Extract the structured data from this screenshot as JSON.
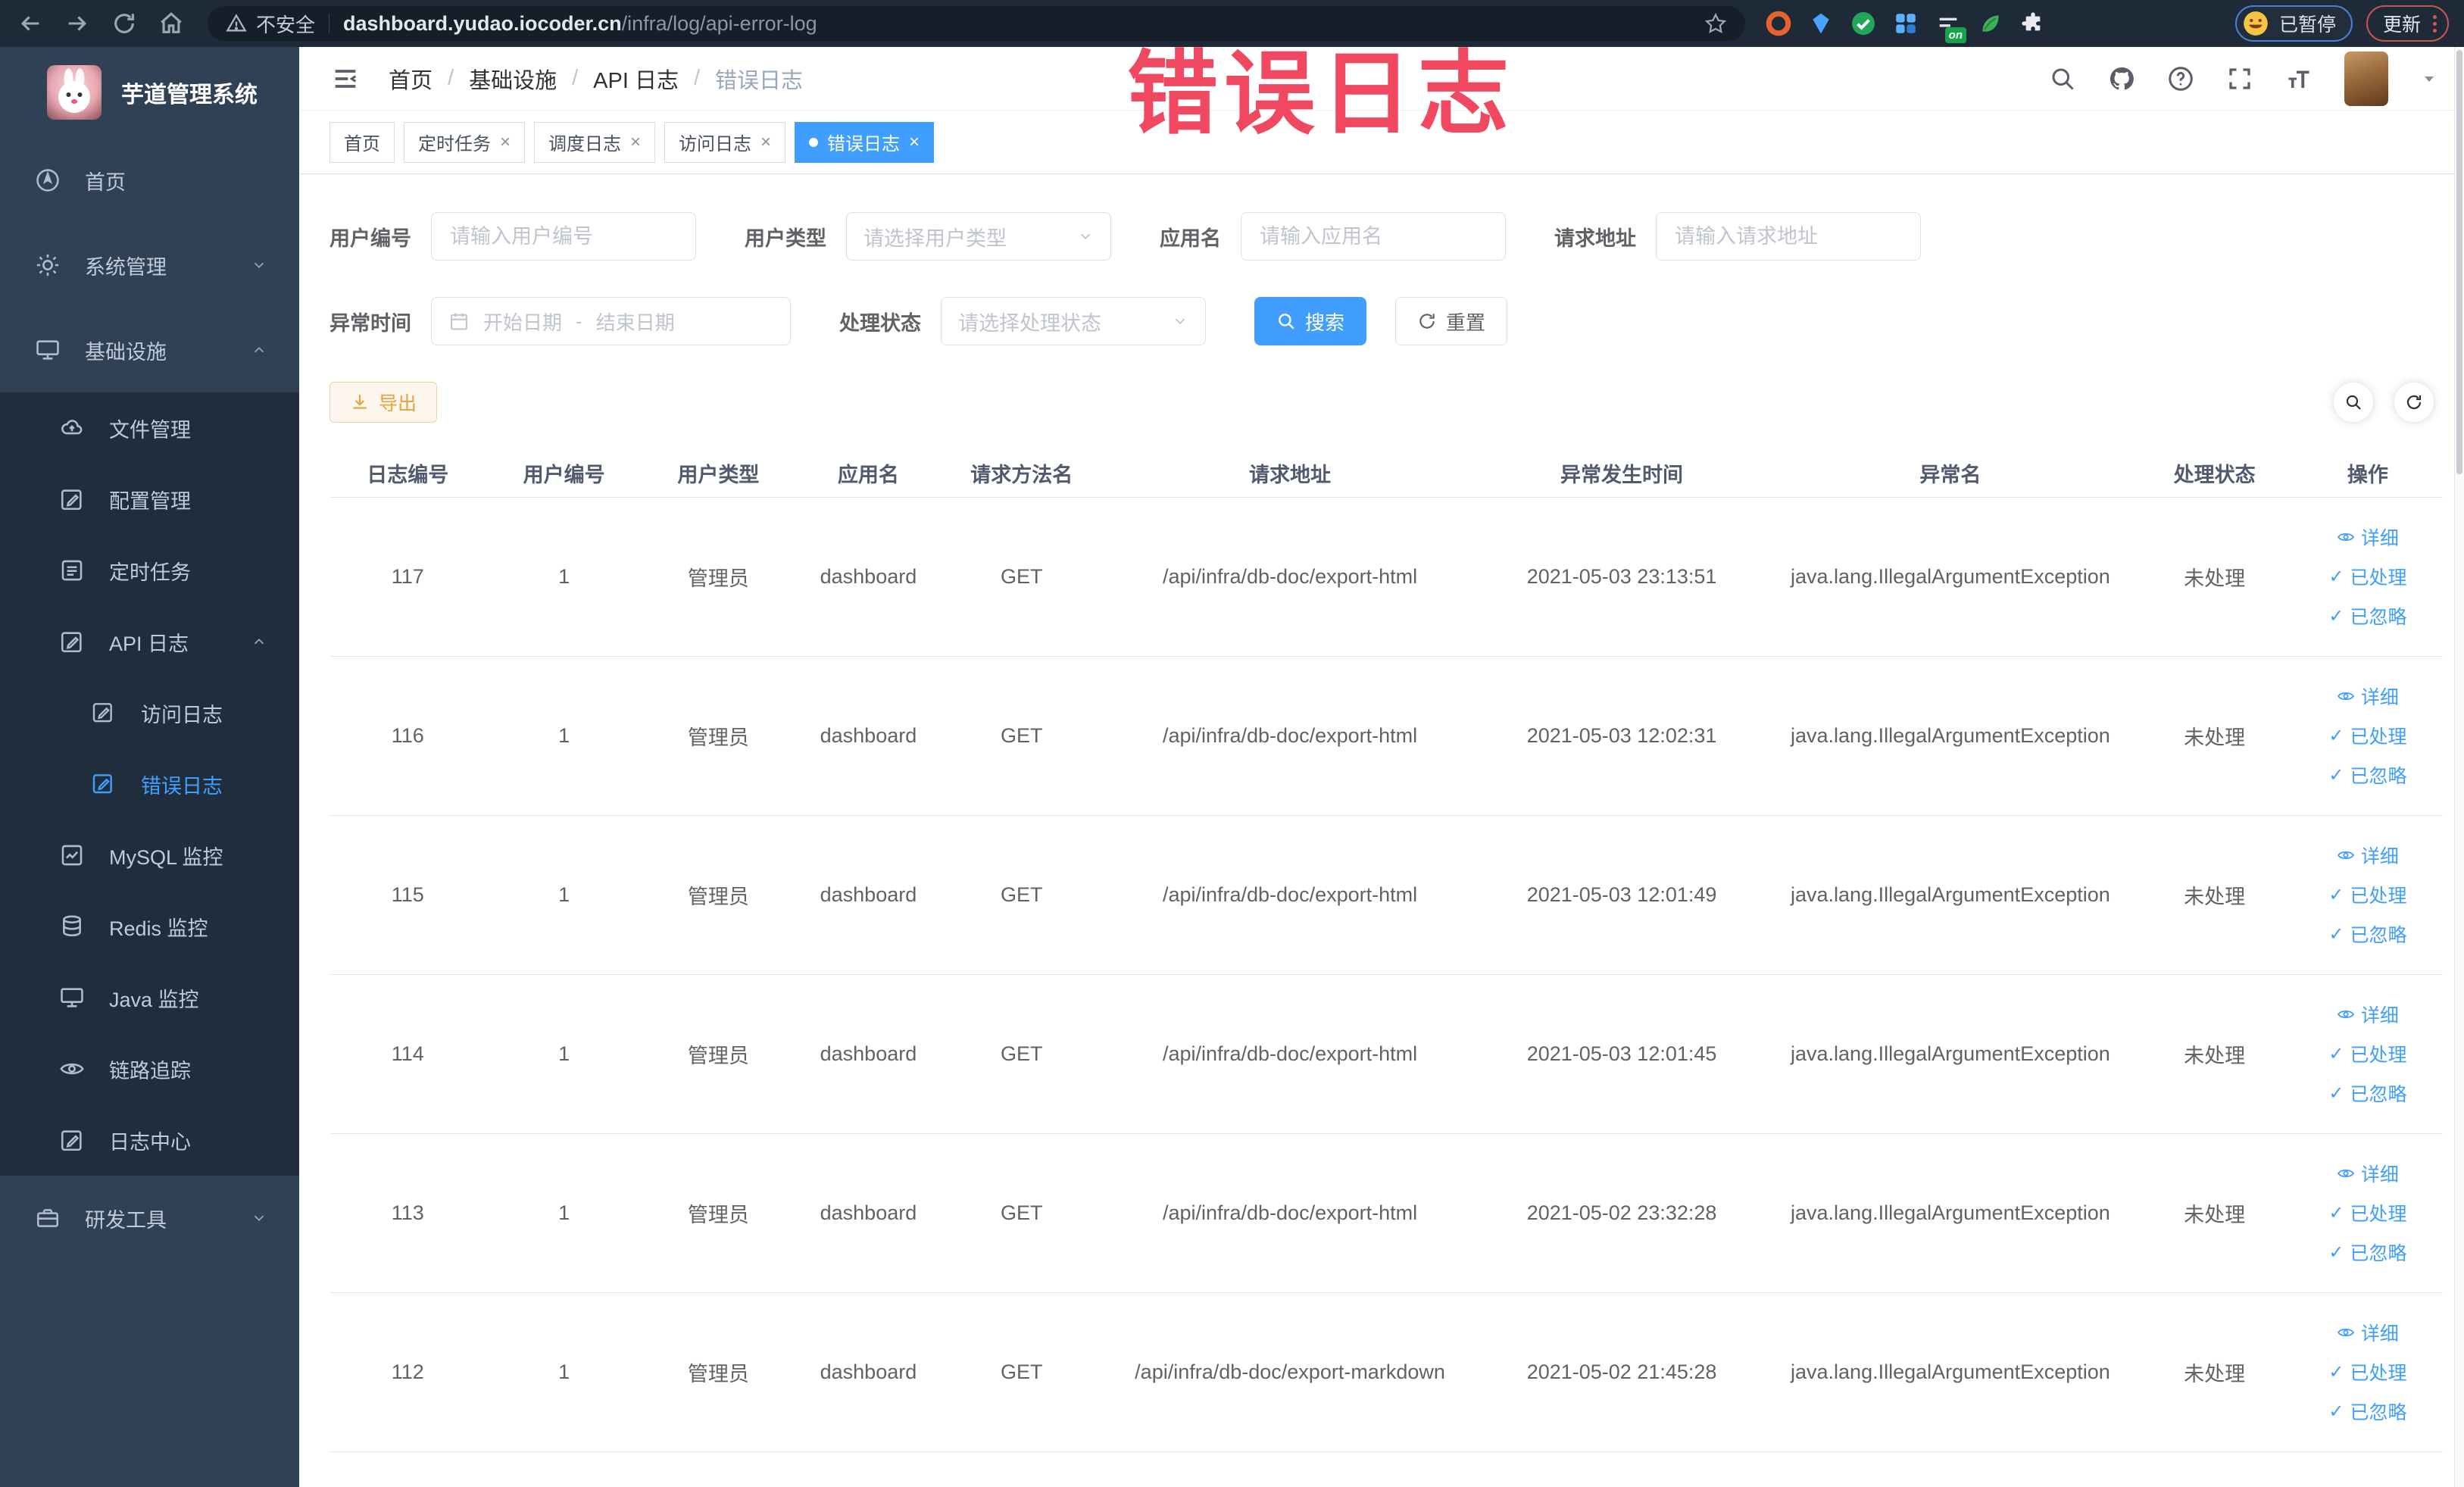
{
  "browser": {
    "security_label": "不安全",
    "url_host": "dashboard.yudao.iocoder.cn",
    "url_path": "/infra/log/api-error-log",
    "extension_badge": "on",
    "profile_label": "已暂停",
    "update_label": "更新"
  },
  "watermark": "错误日志",
  "sidebar": {
    "logo_title": "芋道管理系统",
    "items": [
      {
        "label": "首页"
      },
      {
        "label": "系统管理",
        "chevron": "down"
      },
      {
        "label": "基础设施",
        "chevron": "up",
        "expanded": true
      },
      {
        "label": "文件管理"
      },
      {
        "label": "配置管理"
      },
      {
        "label": "定时任务"
      },
      {
        "label": "API 日志",
        "chevron": "up",
        "expanded": true
      },
      {
        "label": "访问日志"
      },
      {
        "label": "错误日志",
        "active": true
      },
      {
        "label": "MySQL 监控"
      },
      {
        "label": "Redis 监控"
      },
      {
        "label": "Java 监控"
      },
      {
        "label": "链路追踪"
      },
      {
        "label": "日志中心"
      },
      {
        "label": "研发工具",
        "chevron": "down"
      }
    ]
  },
  "header": {
    "breadcrumb": [
      "首页",
      "基础设施",
      "API 日志",
      "错误日志"
    ],
    "breadcrumb_separator": "/"
  },
  "tags": [
    {
      "label": "首页",
      "closable": false,
      "active": false
    },
    {
      "label": "定时任务",
      "closable": true,
      "active": false
    },
    {
      "label": "调度日志",
      "closable": true,
      "active": false
    },
    {
      "label": "访问日志",
      "closable": true,
      "active": false
    },
    {
      "label": "错误日志",
      "closable": true,
      "active": true
    }
  ],
  "filters": {
    "user_id": {
      "label": "用户编号",
      "placeholder": "请输入用户编号",
      "value": ""
    },
    "user_type": {
      "label": "用户类型",
      "placeholder": "请选择用户类型",
      "value": ""
    },
    "app_name": {
      "label": "应用名",
      "placeholder": "请输入应用名",
      "value": ""
    },
    "request_url": {
      "label": "请求地址",
      "placeholder": "请输入请求地址",
      "value": ""
    },
    "exception_time": {
      "label": "异常时间",
      "start_placeholder": "开始日期",
      "separator": "-",
      "end_placeholder": "结束日期"
    },
    "process_status": {
      "label": "处理状态",
      "placeholder": "请选择处理状态",
      "value": ""
    },
    "search_button": "搜索",
    "reset_button": "重置"
  },
  "toolbar": {
    "export_label": "导出"
  },
  "table": {
    "columns": [
      "日志编号",
      "用户编号",
      "用户类型",
      "应用名",
      "请求方法名",
      "请求地址",
      "异常发生时间",
      "异常名",
      "处理状态",
      "操作"
    ],
    "rows": [
      [
        "117",
        "1",
        "管理员",
        "dashboard",
        "GET",
        "/api/infra/db-doc/export-html",
        "2021-05-03 23:13:51",
        "java.lang.IllegalArgumentException",
        "未处理"
      ],
      [
        "116",
        "1",
        "管理员",
        "dashboard",
        "GET",
        "/api/infra/db-doc/export-html",
        "2021-05-03 12:02:31",
        "java.lang.IllegalArgumentException",
        "未处理"
      ],
      [
        "115",
        "1",
        "管理员",
        "dashboard",
        "GET",
        "/api/infra/db-doc/export-html",
        "2021-05-03 12:01:49",
        "java.lang.IllegalArgumentException",
        "未处理"
      ],
      [
        "114",
        "1",
        "管理员",
        "dashboard",
        "GET",
        "/api/infra/db-doc/export-html",
        "2021-05-03 12:01:45",
        "java.lang.IllegalArgumentException",
        "未处理"
      ],
      [
        "113",
        "1",
        "管理员",
        "dashboard",
        "GET",
        "/api/infra/db-doc/export-html",
        "2021-05-02 23:32:28",
        "java.lang.IllegalArgumentException",
        "未处理"
      ],
      [
        "112",
        "1",
        "管理员",
        "dashboard",
        "GET",
        "/api/infra/db-doc/export-markdown",
        "2021-05-02 21:45:28",
        "java.lang.IllegalArgumentException",
        "未处理"
      ]
    ],
    "actions": [
      "详细",
      "已处理",
      "已忽略"
    ]
  },
  "colors": {
    "accent": "#409eff",
    "warning": "#e6a23c",
    "link": "#409eff",
    "watermark": "#f04860",
    "sidebar_bg": "#304156",
    "submenu_bg": "#1f2d3d",
    "active_tag_bg": "#409eff",
    "browser_bar_bg": "#1e2a38"
  }
}
